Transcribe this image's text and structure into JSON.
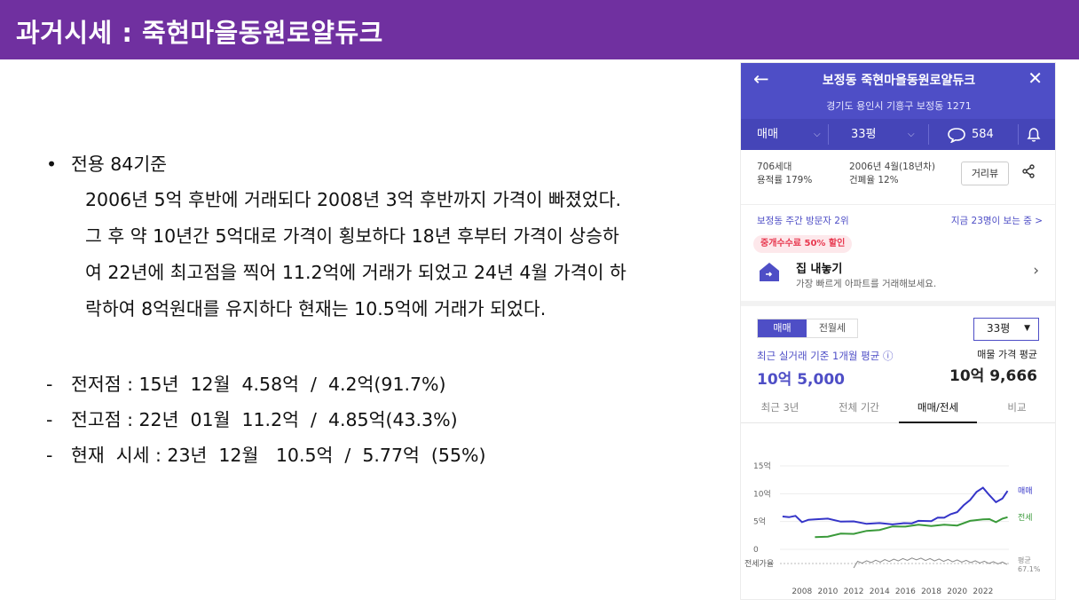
{
  "slide": {
    "title": "과거시세 : 죽현마을동원로얄듀크",
    "bullet_symbol": "•",
    "bullet_title": "전용 84기준",
    "paragraph_lines": [
      "2006년  5억  후반에  거래되다  2008년  3억  후반까지  가격이  빠졌었다.",
      "그  후  약  10년간  5억대로  가격이  횡보하다  18년  후부터  가격이  상승하",
      "여  22년에  최고점을  찍어  11.2억에  거래가  되었고  24년  4월  가격이  하",
      "락하여  8억원대를  유지하다  현재는  10.5억에  거래가  되었다."
    ],
    "dash_symbol": "-",
    "dash_items": [
      "전저점 : 15년  12월  4.58억  /  4.2억(91.7%)",
      "전고점 : 22년  01월  11.2억  /  4.85억(43.3%)",
      "현재  시세 : 23년  12월   10.5억  /  5.77억  (55%)"
    ]
  },
  "app": {
    "back_icon": "←",
    "close_icon": "✕",
    "apt_name": "보정동 죽현마을동원로얄듀크",
    "address": "경기도 용인시 기흥구 보정동 1271",
    "filters": {
      "deal_type": "매매",
      "size": "33평",
      "comments_count": "584",
      "chevron": "⌵"
    },
    "info": {
      "households": "706세대",
      "floor_area_ratio": "용적률 179%",
      "built": "2006년 4월(18년차)",
      "coverage_ratio": "건폐율 12%",
      "review_button": "거리뷰"
    },
    "visit": {
      "left": "보정동 주간 방문자 2위",
      "right": "지금 23명이 보는 중  >"
    },
    "promo": {
      "badge": "중개수수료 50% 할인",
      "heading": "집 내놓기",
      "sub": "가장 빠르게 아파트를 거래해보세요.",
      "arrow": "›"
    },
    "segment": {
      "active": "매매",
      "inactive": "전월세"
    },
    "size_select": {
      "value": "33평",
      "caret": "▼"
    },
    "avg_label": "최근 실거래 기준 1개월 평균 ⓘ",
    "avg_value": "10억 5,000",
    "ask_label": "매물 가격 평균",
    "ask_value": "10억 9,666",
    "tabs": [
      "최근 3년",
      "전체 기간",
      "매매/전세",
      "비교"
    ],
    "active_tab_index": 2,
    "colors": {
      "brand": "#4E4EC6",
      "sale_line": "#3535C8",
      "jeonse_line": "#3A9A3A",
      "ratio_line": "#8A8A8A",
      "slide_header": "#7030A0"
    }
  },
  "chart_data": {
    "type": "line",
    "title": "",
    "ylabel": "",
    "ylim": [
      0,
      15
    ],
    "yticks": [
      "15억",
      "10억",
      "5억",
      "0"
    ],
    "xticks": [
      "2008",
      "2010",
      "2012",
      "2014",
      "2016",
      "2018",
      "2020",
      "2022"
    ],
    "series": [
      {
        "name": "매매",
        "x": [
          2006.5,
          2007.0,
          2007.5,
          2008.0,
          2008.5,
          2009.0,
          2010.0,
          2011.0,
          2012.0,
          2013.0,
          2014.0,
          2015.0,
          2015.9,
          2016.5,
          2017.0,
          2018.0,
          2018.5,
          2019.0,
          2019.5,
          2020.0,
          2020.5,
          2021.0,
          2021.5,
          2022.0,
          2022.5,
          2023.0,
          2023.5,
          2023.9
        ],
        "values": [
          5.9,
          5.9,
          5.9,
          5.0,
          5.2,
          5.5,
          5.4,
          5.1,
          4.9,
          4.7,
          4.6,
          4.6,
          4.58,
          4.8,
          5.0,
          5.2,
          5.6,
          5.8,
          6.2,
          6.8,
          7.8,
          9.0,
          10.2,
          11.2,
          9.6,
          8.6,
          9.0,
          10.5
        ]
      },
      {
        "name": "전세",
        "x": [
          2009.0,
          2010.0,
          2011.0,
          2012.0,
          2013.0,
          2014.0,
          2015.0,
          2016.0,
          2017.0,
          2018.0,
          2019.0,
          2020.0,
          2021.0,
          2022.0,
          2022.5,
          2023.0,
          2023.5,
          2023.9
        ],
        "values": [
          2.2,
          2.4,
          2.7,
          2.9,
          3.2,
          3.6,
          4.0,
          4.2,
          4.3,
          4.3,
          4.3,
          4.4,
          5.0,
          5.5,
          5.3,
          5.0,
          5.4,
          5.77
        ]
      }
    ],
    "ratio_panel": {
      "label": "전세가율",
      "avg_label": "평균",
      "avg_value": "67.1%"
    },
    "legend_placement": "right"
  }
}
